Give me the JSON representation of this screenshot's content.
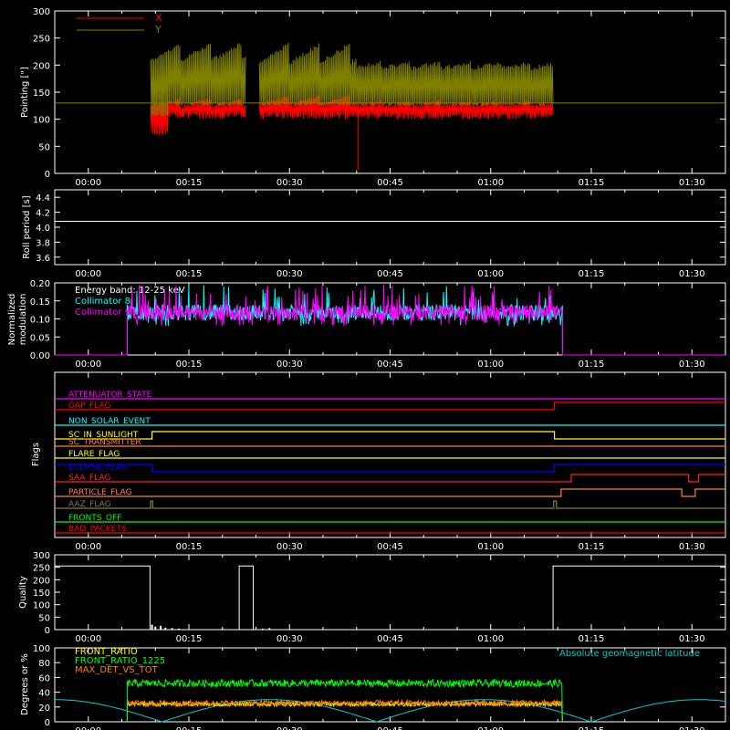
{
  "x_time_labels": [
    "00:00",
    "00:15",
    "00:30",
    "00:45",
    "01:00",
    "01:15",
    "01:30"
  ],
  "chart_data": [
    {
      "type": "line",
      "ylabel": "Pointing [\"]",
      "ylim": [
        0,
        300
      ],
      "yticks": [
        0,
        50,
        100,
        150,
        200,
        250,
        300
      ],
      "series": [
        {
          "name": "X",
          "color": "#ff0000"
        },
        {
          "name": "Y",
          "color": "#808000"
        }
      ],
      "horizontal_line": 130
    },
    {
      "type": "line",
      "ylabel": "Roll period [s]",
      "ylim": [
        3.5,
        4.5
      ],
      "yticks": [
        3.6,
        3.8,
        4.0,
        4.2,
        4.4
      ],
      "ytick_labels": [
        "3.6",
        "3.8",
        "4.0",
        "4.2",
        "4.4"
      ],
      "value": 4.08
    },
    {
      "type": "line",
      "ylabel": "Normalized modulation",
      "ylabel_lines": [
        "Normalized",
        "modulation"
      ],
      "ylim": [
        0,
        0.2
      ],
      "yticks": [
        0,
        0.05,
        0.1,
        0.15,
        0.2
      ],
      "ytick_labels": [
        "0.00",
        "0.05",
        "0.10",
        "0.15",
        "0.20"
      ],
      "annotation": "Energy band: 12-25 keV",
      "series": [
        {
          "name": "Collimator 8",
          "color": "#00ffff"
        },
        {
          "name": "Collimator 9",
          "color": "#ff00ff"
        }
      ]
    },
    {
      "type": "line",
      "ylabel": "Flags",
      "series": [
        {
          "name": "ATTENUATOR_STATE",
          "color": "#ff00ff"
        },
        {
          "name": "GAP_FLAG",
          "color": "#ff0000"
        },
        {
          "name": "NON_SOLAR_EVENT",
          "color": "#00ffff"
        },
        {
          "name": "SC_IN_SUNLIGHT",
          "color": "#ffff00"
        },
        {
          "name": "SC_TRANSMITTER",
          "color": "#ff8040"
        },
        {
          "name": "FLARE_FLAG",
          "color": "#ffff00"
        },
        {
          "name": "ECLIPSE_FLAG",
          "color": "#0000ff"
        },
        {
          "name": "SAA_FLAG",
          "color": "#ff2020"
        },
        {
          "name": "PARTICLE_FLAG",
          "color": "#ff8040"
        },
        {
          "name": "AAZ_FLAG",
          "color": "#808040"
        },
        {
          "name": "FRONTS_OFF",
          "color": "#00ff00"
        },
        {
          "name": "BAD_PACKETS",
          "color": "#ff0000"
        }
      ]
    },
    {
      "type": "line",
      "ylabel": "Quality",
      "ylim": [
        0,
        300
      ],
      "yticks": [
        0,
        50,
        100,
        150,
        200,
        250,
        300
      ]
    },
    {
      "type": "line",
      "ylabel": "Degrees or %",
      "ylim": [
        0,
        100
      ],
      "yticks": [
        0,
        20,
        40,
        60,
        80,
        100
      ],
      "series": [
        {
          "name": "FRONT_RATIO",
          "color": "#ffff00"
        },
        {
          "name": "FRONT_RATIO_1225",
          "color": "#00ff00"
        },
        {
          "name": "MAX_DET_VS_TOT",
          "color": "#ff8000"
        },
        {
          "name": "Absolute geomagnetic latitude",
          "color": "#00cccc"
        }
      ]
    }
  ]
}
